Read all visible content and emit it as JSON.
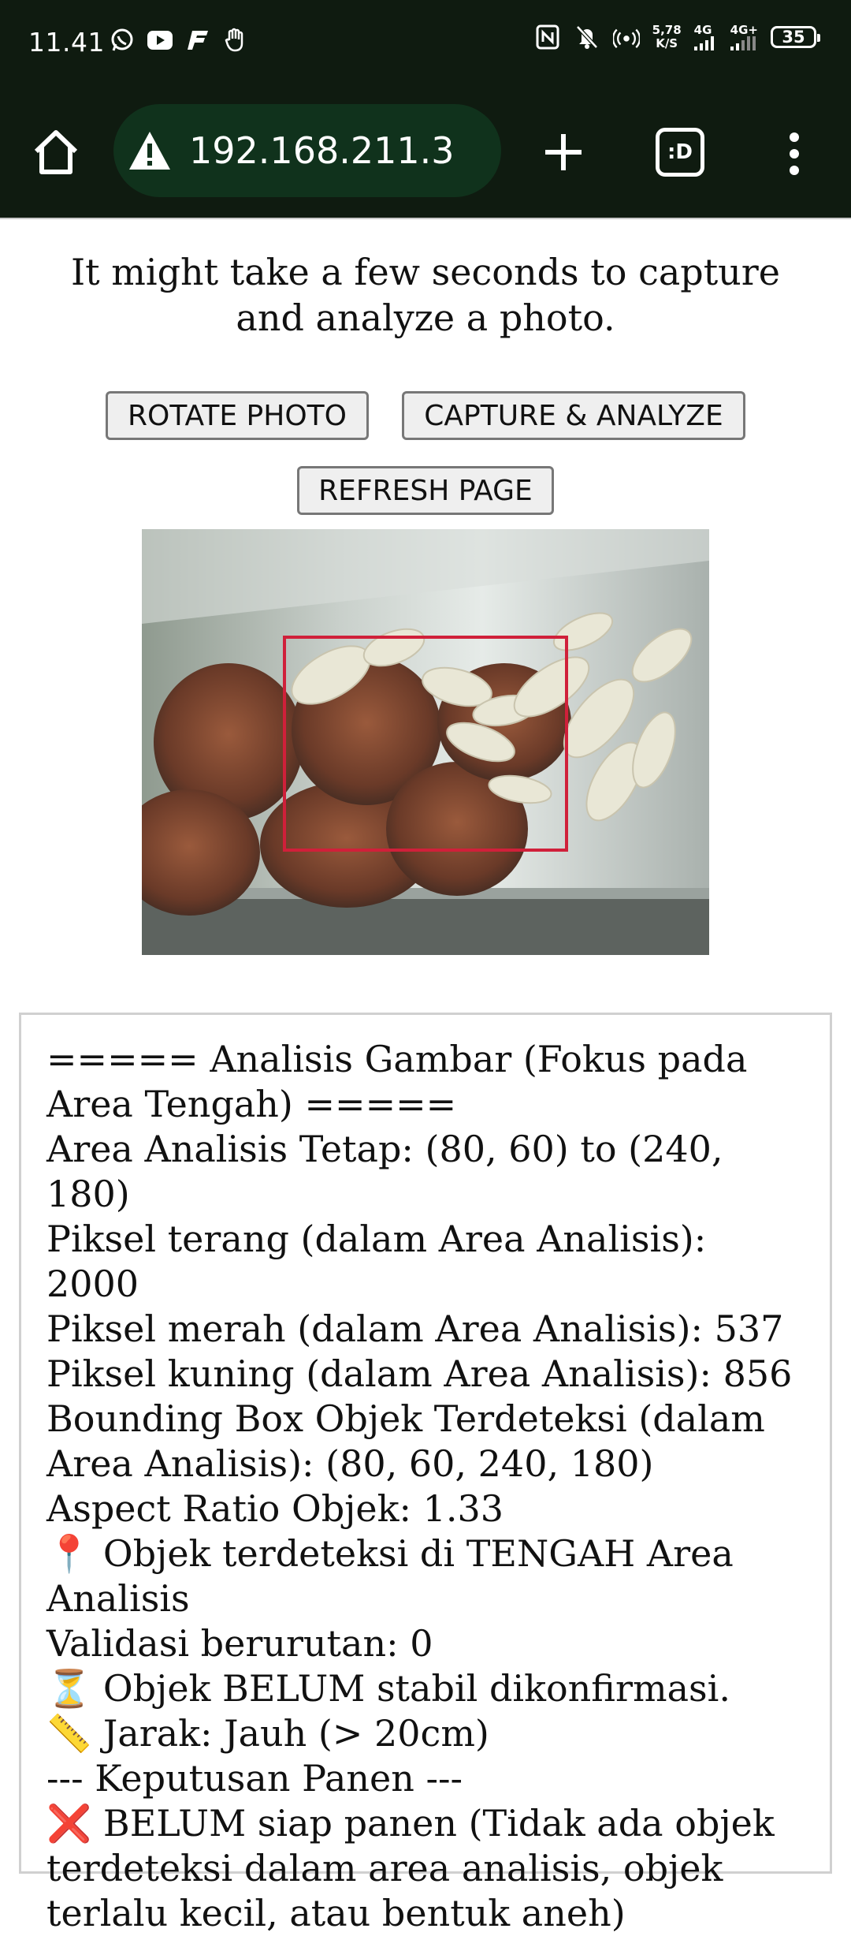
{
  "status_bar": {
    "time": "11.41",
    "left_icons": [
      "whatsapp-icon",
      "youtube-icon",
      "app-icon",
      "gesture-icon"
    ],
    "right_icons": [
      "nfc-icon",
      "mute-icon",
      "hotspot-icon"
    ],
    "speed_value": "5,78",
    "speed_unit": "K/S",
    "net1": "4G",
    "net2": "4G+",
    "battery": "35"
  },
  "browser": {
    "url": "192.168.211.3",
    "tabs_label": ":D"
  },
  "page": {
    "intro": "It might take a few seconds to capture and analyze a photo.",
    "buttons": {
      "rotate": "ROTATE PHOTO",
      "capture": "CAPTURE & ANALYZE",
      "refresh": "REFRESH PAGE"
    },
    "analysis": {
      "header": "===== Analisis Gambar (Fokus pada Area Tengah) =====",
      "area": "Area Analisis Tetap: (80, 60) to (240, 180)",
      "bright": "Piksel terang (dalam Area Analisis): 2000",
      "red": "Piksel merah (dalam Area Analisis): 537",
      "yellow": "Piksel kuning (dalam Area Analisis): 856",
      "bbox": "Bounding Box Objek Terdeteksi (dalam Area Analisis): (80, 60, 240, 180)",
      "aspect": "Aspect Ratio Objek: 1.33",
      "center": "📍 Objek terdeteksi di TENGAH Area Analisis",
      "validation": "Validasi berurutan: 0",
      "stable": "⏳ Objek BELUM stabil dikonfirmasi.",
      "distance": "📏 Jarak: Jauh (> 20cm)",
      "decision_header": "--- Keputusan Panen ---",
      "decision": "❌ BELUM siap panen (Tidak ada objek terdeteksi dalam area analisis, objek terlalu kecil, atau bentuk aneh)"
    }
  },
  "colors": {
    "status_bg": "#0f1b10",
    "url_pill": "#10321c",
    "detection_box": "#d0203a"
  }
}
